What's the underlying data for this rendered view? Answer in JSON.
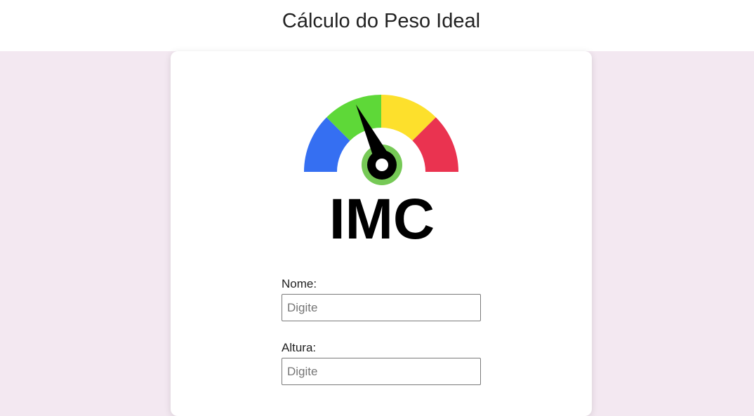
{
  "header": {
    "title": "Cálculo do Peso Ideal"
  },
  "logo": {
    "text": "IMC"
  },
  "form": {
    "nome": {
      "label": "Nome:",
      "placeholder": "Digite",
      "value": ""
    },
    "altura": {
      "label": "Altura:",
      "placeholder": "Digite",
      "value": ""
    }
  },
  "colors": {
    "page_background": "#f3e8f1",
    "gauge_blue": "#356ff2",
    "gauge_green": "#5ed838",
    "gauge_yellow": "#fde02c",
    "gauge_red": "#ea3350",
    "hub_ring": "#76c956"
  }
}
